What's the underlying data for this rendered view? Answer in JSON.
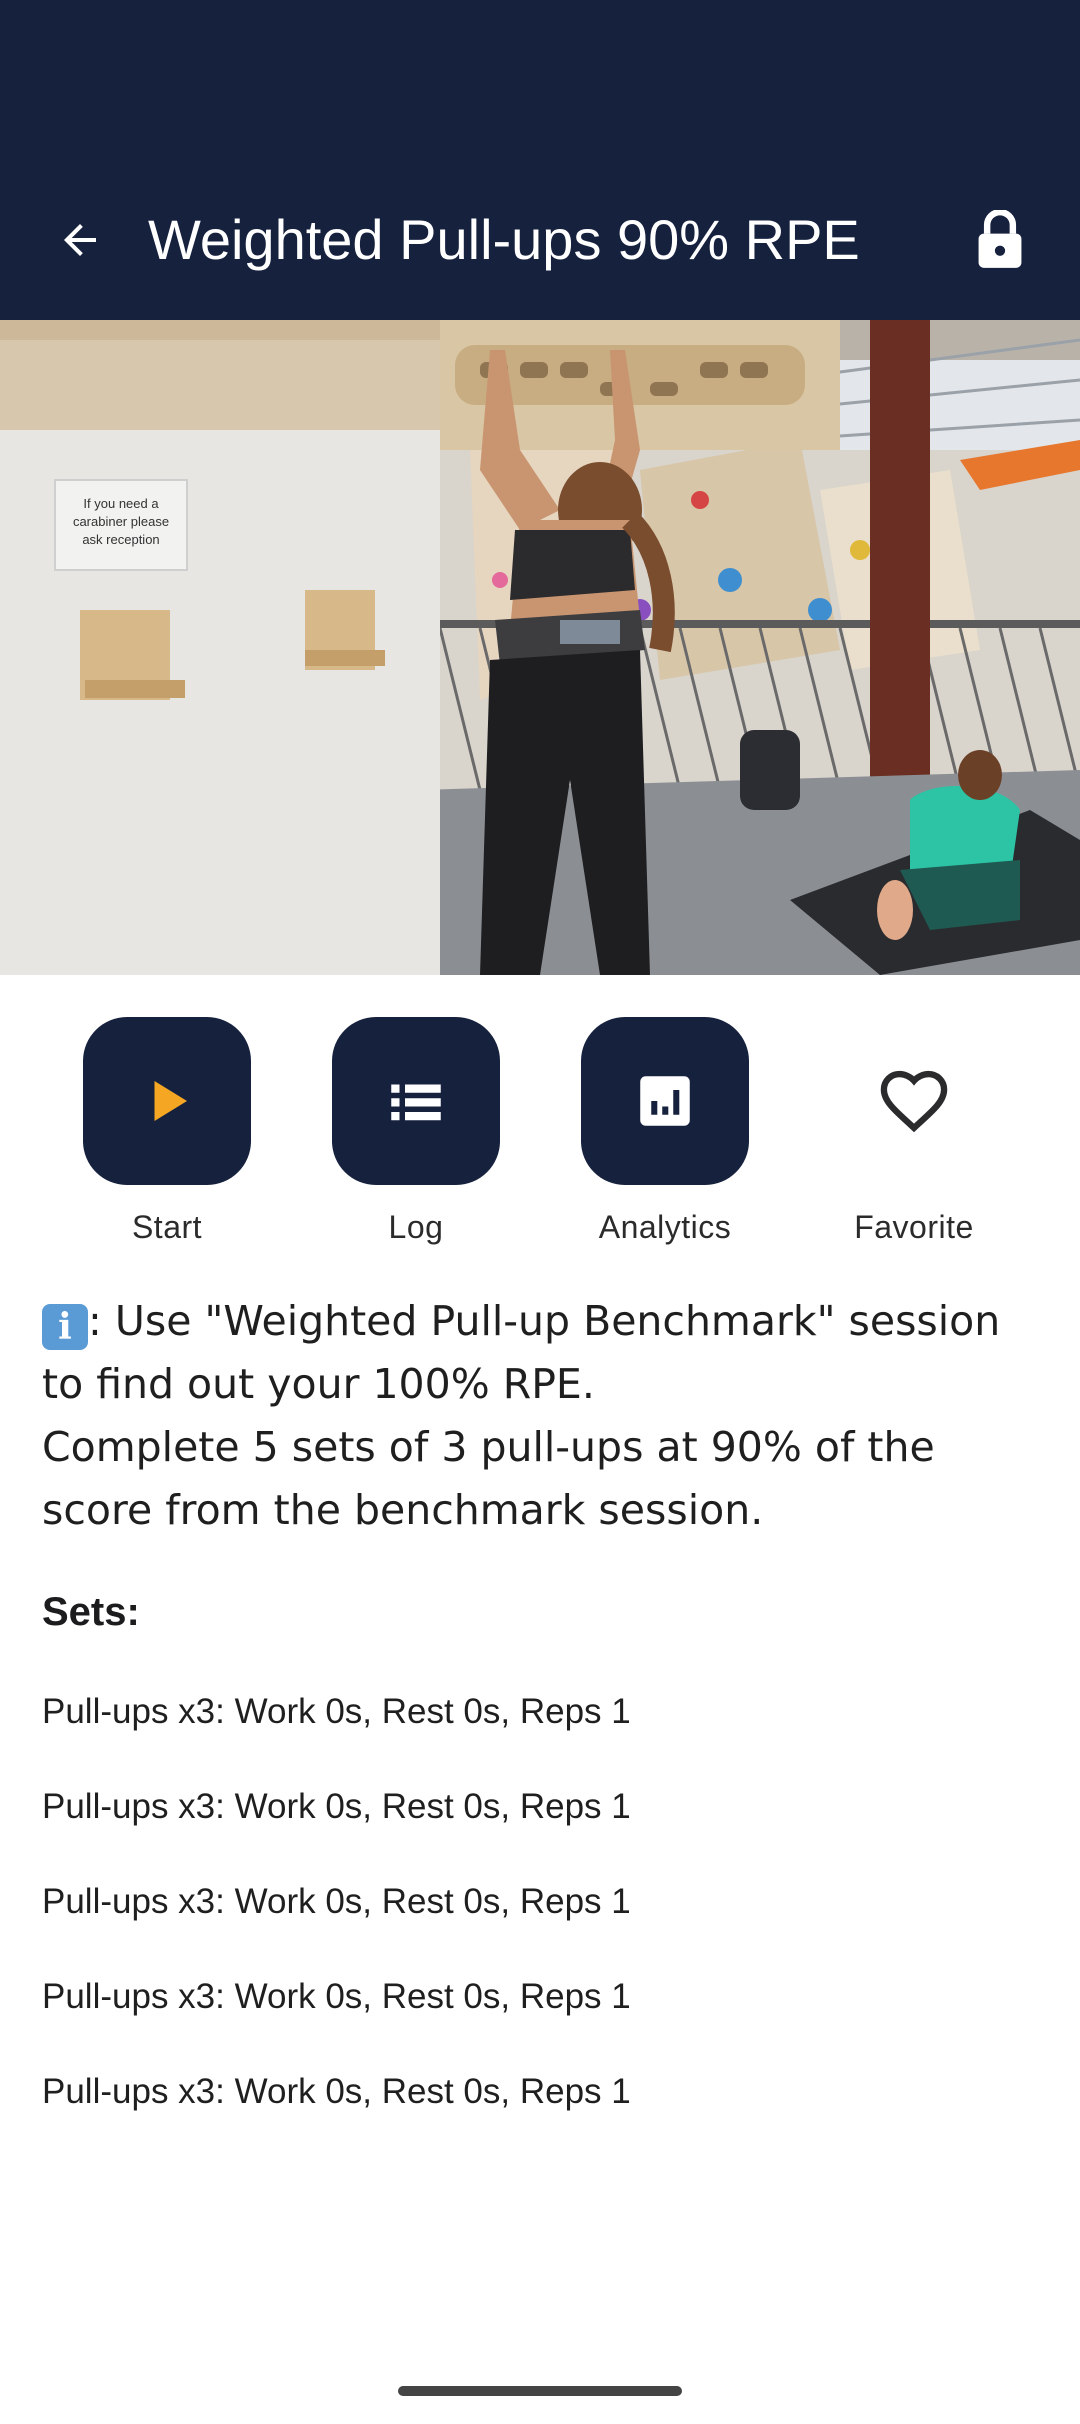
{
  "app_bar": {
    "title": "Weighted Pull-ups 90% RPE",
    "back_icon": "arrow-back-icon",
    "lock_icon": "lock-icon",
    "background": "#16213e"
  },
  "actions": [
    {
      "label": "Start",
      "icon": "play-icon"
    },
    {
      "label": "Log",
      "icon": "list-icon"
    },
    {
      "label": "Analytics",
      "icon": "bar-chart-icon"
    },
    {
      "label": "Favorite",
      "icon": "heart-outline-icon"
    }
  ],
  "description": {
    "info_emoji": "i",
    "line1": ": Use \"Weighted Pull-up Benchmark\" session to find out your 100% RPE.",
    "line2": "Complete 5 sets of 3 pull-ups at 90% of the score from the benchmark session."
  },
  "sets": {
    "title": "Sets:",
    "items": [
      "Pull-ups x3: Work 0s, Rest 0s, Reps 1",
      "Pull-ups x3: Work 0s, Rest 0s, Reps 1",
      "Pull-ups x3: Work 0s, Rest 0s, Reps 1",
      "Pull-ups x3: Work 0s, Rest 0s, Reps 1",
      "Pull-ups x3: Work 0s, Rest 0s, Reps 1"
    ]
  },
  "hero": {
    "sign_text_1": "If you need a",
    "sign_text_2": "carabiner please",
    "sign_text_3": "ask reception"
  },
  "colors": {
    "primary": "#16213e",
    "play_accent": "#f5a623",
    "info_blue": "#5b9bd5"
  }
}
